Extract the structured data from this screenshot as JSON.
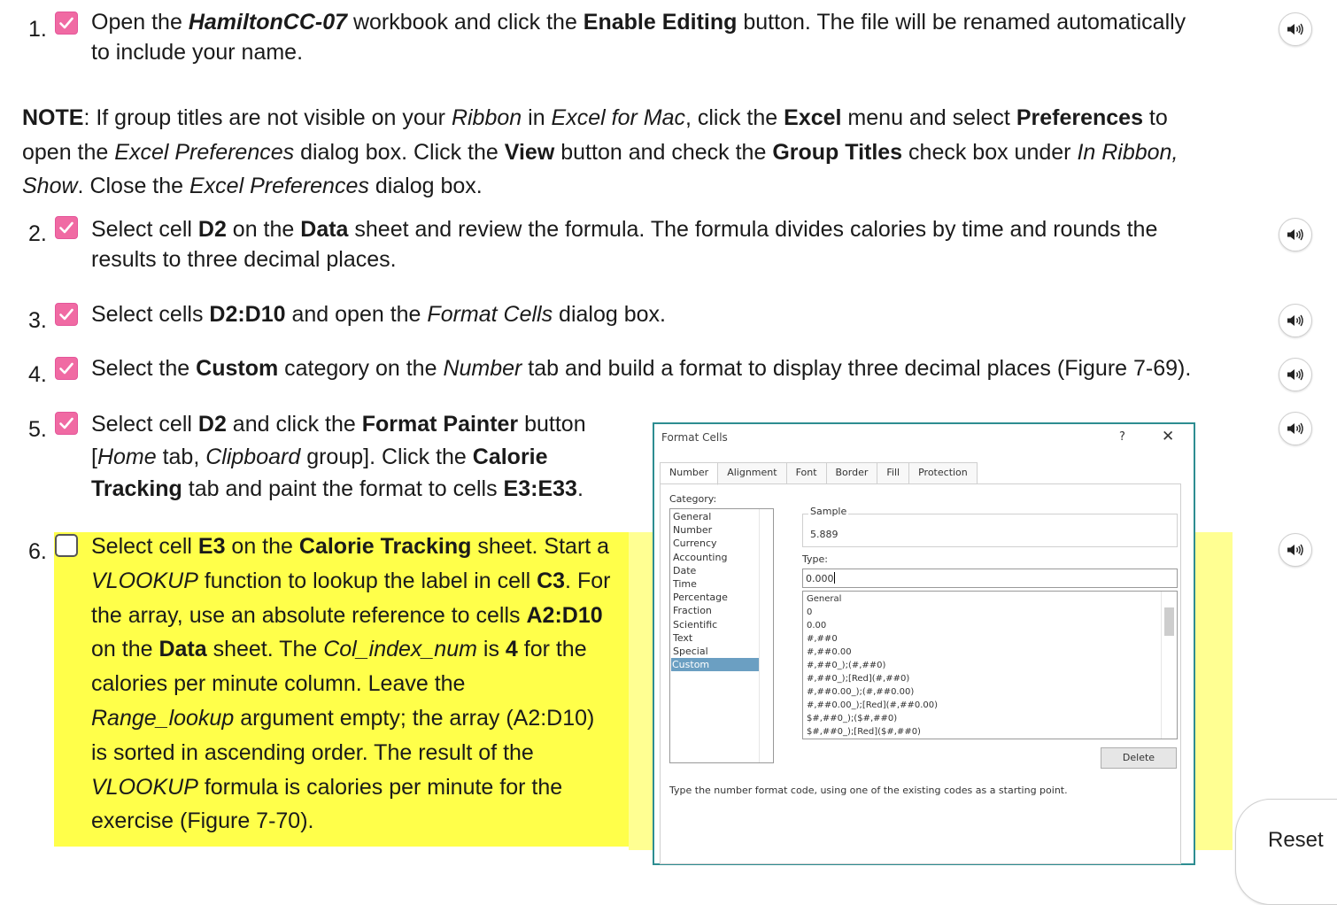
{
  "steps": [
    {
      "num": "1.",
      "checked": true,
      "lines": [
        [
          "Open the ",
          {
            "bi": "HamiltonCC-07"
          },
          " workbook and click the ",
          {
            "b": "Enable Editing"
          },
          " button. The file will be renamed automatically"
        ],
        [
          "to include your name."
        ]
      ]
    },
    {
      "num": "2.",
      "checked": true,
      "lines": [
        [
          "Select cell ",
          {
            "b": "D2"
          },
          " on the ",
          {
            "b": "Data"
          },
          " sheet and review the formula. The formula divides calories by time and rounds the"
        ],
        [
          "results to three decimal places."
        ]
      ]
    },
    {
      "num": "3.",
      "checked": true,
      "lines": [
        [
          "Select cells ",
          {
            "b": "D2:D10"
          },
          " and open the ",
          {
            "i": "Format Cells"
          },
          " dialog box."
        ]
      ]
    },
    {
      "num": "4.",
      "checked": true,
      "lines": [
        [
          "Select the ",
          {
            "b": "Custom"
          },
          " category on the ",
          {
            "i": "Number"
          },
          " tab and build a format to display three decimal places (Figure 7-69)."
        ]
      ]
    },
    {
      "num": "5.",
      "checked": true,
      "lines": [
        [
          "Select cell ",
          {
            "b": "D2"
          },
          " and click the ",
          {
            "b": "Format Painter"
          },
          " button"
        ],
        [
          "[",
          {
            "i": "Home"
          },
          " tab, ",
          {
            "i": "Clipboard"
          },
          " group]. Click the ",
          {
            "b": "Calorie"
          }
        ],
        [
          {
            "b": "Tracking"
          },
          " tab and paint the format to cells ",
          {
            "b": "E3:E33"
          },
          "."
        ]
      ]
    },
    {
      "num": "6.",
      "checked": false,
      "lines": [
        [
          "Select cell ",
          {
            "b": "E3"
          },
          " on the ",
          {
            "b": "Calorie Tracking"
          },
          " sheet. Start a"
        ],
        [
          {
            "i": "VLOOKUP"
          },
          " function to lookup the label in cell ",
          {
            "b": "C3"
          },
          ". For"
        ],
        [
          "the array, use an absolute reference to cells ",
          {
            "b": "A2:D10"
          }
        ],
        [
          "on the ",
          {
            "b": "Data"
          },
          " sheet. The ",
          {
            "i": "Col_index_num"
          },
          " is ",
          {
            "b": "4"
          },
          " for the"
        ],
        [
          "calories per minute column. Leave the"
        ],
        [
          {
            "i": "Range_lookup"
          },
          " argument empty; the array (A2:D10)"
        ],
        [
          "is sorted in ascending order. The result of the"
        ],
        [
          {
            "i": "VLOOKUP"
          },
          " formula is calories per minute for the"
        ],
        [
          "exercise (Figure 7-70)."
        ]
      ]
    }
  ],
  "note": {
    "lines": [
      [
        {
          "b": "NOTE"
        },
        ": If group titles are not visible on your ",
        {
          "i": "Ribbon"
        },
        " in ",
        {
          "i": "Excel for Mac"
        },
        ", click the ",
        {
          "b": "Excel"
        },
        " menu and select ",
        {
          "b": "Preferences"
        },
        " to"
      ],
      [
        "open the ",
        {
          "i": "Excel Preferences"
        },
        " dialog box. Click the ",
        {
          "b": "View"
        },
        " button and check the ",
        {
          "b": "Group Titles"
        },
        " check box under ",
        {
          "i": "In Ribbon,"
        }
      ],
      [
        {
          "i": "Show"
        },
        ". Close the ",
        {
          "i": "Excel Preferences"
        },
        " dialog box."
      ]
    ]
  },
  "dialog": {
    "title": "Format Cells",
    "help": "?",
    "close": "✕",
    "tabs": [
      "Number",
      "Alignment",
      "Font",
      "Border",
      "Fill",
      "Protection"
    ],
    "category_label": "Category:",
    "categories": [
      "General",
      "Number",
      "Currency",
      "Accounting",
      "Date",
      "Time",
      "Percentage",
      "Fraction",
      "Scientific",
      "Text",
      "Special",
      "Custom"
    ],
    "selected_category": "Custom",
    "sample_label": "Sample",
    "sample_value": "5.889",
    "type_label": "Type:",
    "type_value": "0.000",
    "formats": [
      "General",
      "0",
      "0.00",
      "#,##0",
      "#,##0.00",
      "#,##0_);(#,##0)",
      "#,##0_);[Red](#,##0)",
      "#,##0.00_);(#,##0.00)",
      "#,##0.00_);[Red](#,##0.00)",
      "$#,##0_);($#,##0)",
      "$#,##0_);[Red]($#,##0)"
    ],
    "delete_label": "Delete",
    "hint": "Type the number format code, using one of the existing codes as a starting point."
  },
  "reset_label": "Reset",
  "colors": {
    "check": "#f06aa3",
    "highlight": "#ffff4a",
    "dialog_border": "#2d8d91"
  },
  "icons": {
    "speaker": "speaker-icon",
    "check": "checkmark-icon"
  }
}
